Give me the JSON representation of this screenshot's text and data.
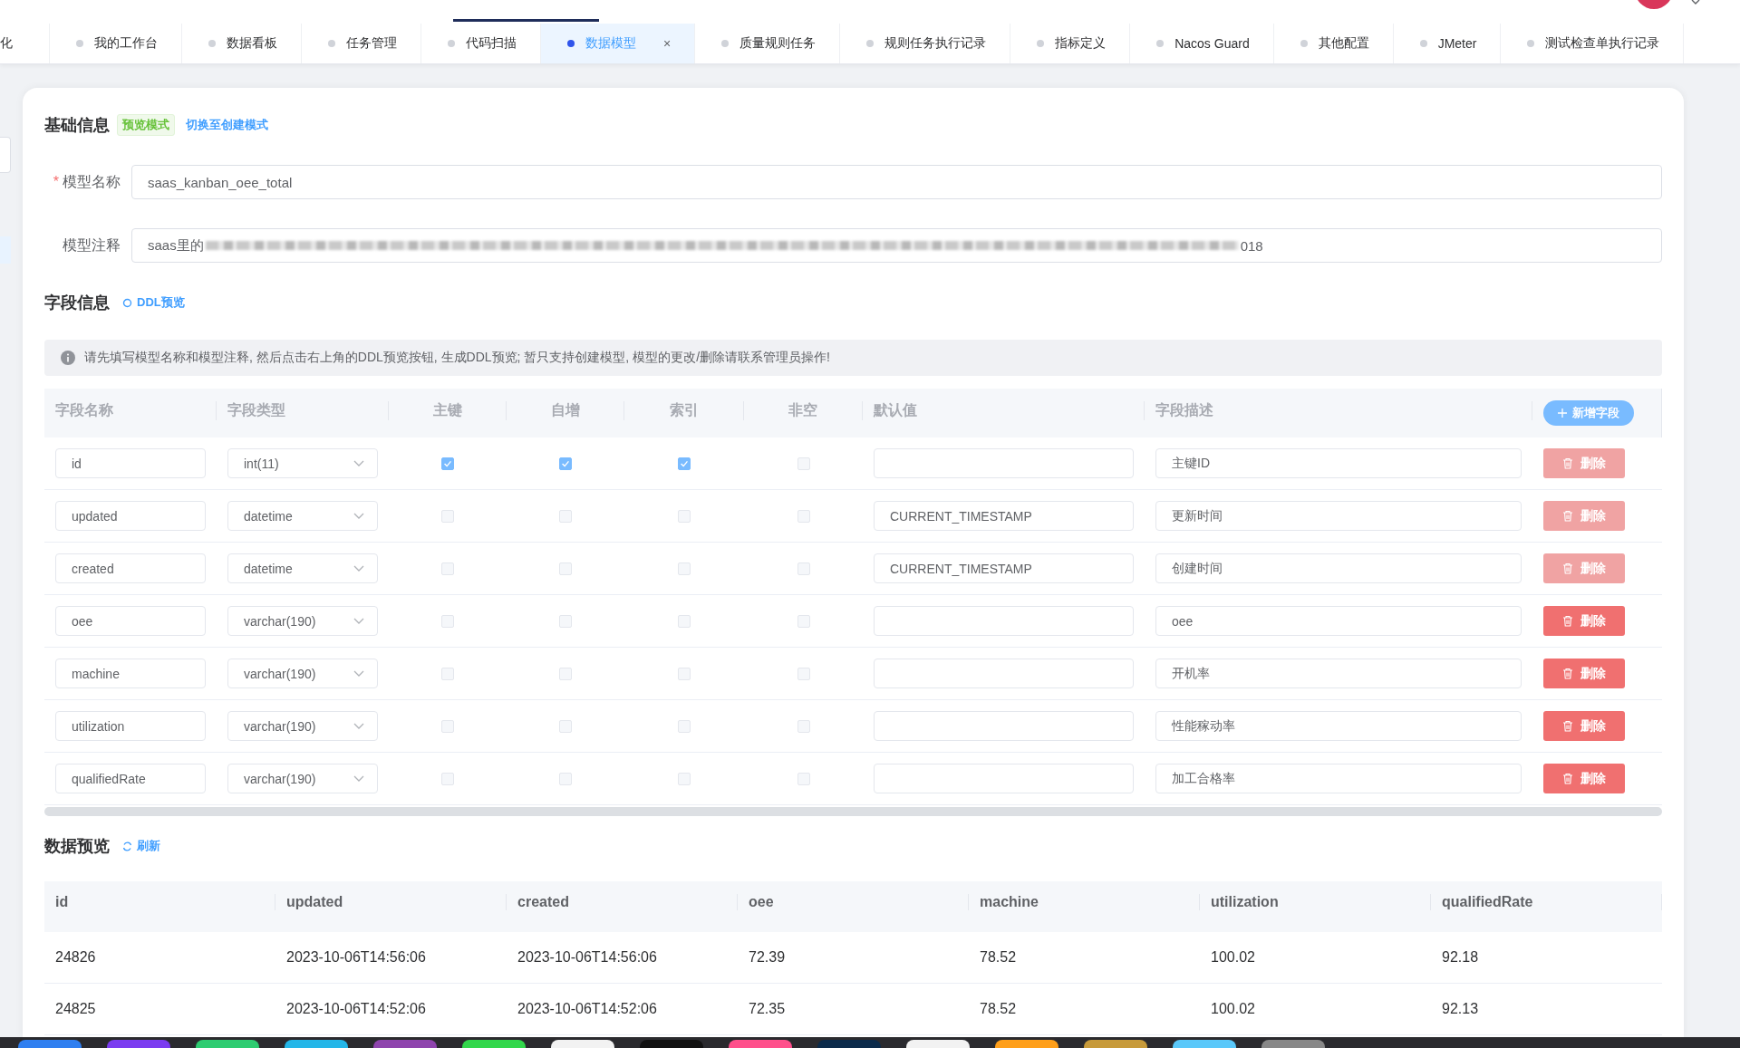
{
  "tabs": [
    {
      "label": "化",
      "kind": "cut",
      "selected": false
    },
    {
      "label": "我的工作台",
      "kind": "tab",
      "selected": false
    },
    {
      "label": "数据看板",
      "kind": "tab",
      "selected": false
    },
    {
      "label": "任务管理",
      "kind": "tab",
      "selected": false
    },
    {
      "label": "代码扫描",
      "kind": "tab",
      "selected": false
    },
    {
      "label": "数据模型",
      "kind": "tab",
      "selected": true,
      "close": "×"
    },
    {
      "label": "质量规则任务",
      "kind": "tab",
      "selected": false
    },
    {
      "label": "规则任务执行记录",
      "kind": "tab",
      "selected": false
    },
    {
      "label": "指标定义",
      "kind": "tab",
      "selected": false
    },
    {
      "label": "Nacos Guard",
      "kind": "tab",
      "selected": false
    },
    {
      "label": "其他配置",
      "kind": "tab",
      "selected": false
    },
    {
      "label": "JMeter",
      "kind": "tab",
      "selected": false
    },
    {
      "label": "测试检查单执行记录",
      "kind": "tab",
      "selected": false
    }
  ],
  "basic_info": {
    "title": "基础信息",
    "mode_tag": "预览模式",
    "switch_link": "切换至创建模式",
    "fields": [
      {
        "label": "模型名称",
        "required_mark": "*",
        "value": "saas_kanban_oee_total"
      },
      {
        "label": "模型注释",
        "value": "saas里的",
        "redacted": true,
        "value_end": "018"
      }
    ]
  },
  "field_info": {
    "title": "字段信息",
    "ddl_link": "DDL预览",
    "alert": "请先填写模型名称和模型注释, 然后点击右上角的DDL预览按钮, 生成DDL预览; 暂只支持创建模型, 模型的更改/删除请联系管理员操作!",
    "add_button": "新增字段",
    "columns": [
      "字段名称",
      "字段类型",
      "主键",
      "自增",
      "索引",
      "非空",
      "默认值",
      "字段描述"
    ],
    "rows": [
      {
        "name": "id",
        "type": "int(11)",
        "primary_key": true,
        "auto_increment": true,
        "index": true,
        "not_null": false,
        "default": "",
        "description": "主键ID",
        "delete_label": "删除",
        "delete_disabled": true
      },
      {
        "name": "updated",
        "type": "datetime",
        "primary_key": false,
        "auto_increment": false,
        "index": false,
        "not_null": false,
        "default": "CURRENT_TIMESTAMP",
        "description": "更新时间",
        "delete_label": "删除",
        "delete_disabled": true
      },
      {
        "name": "created",
        "type": "datetime",
        "primary_key": false,
        "auto_increment": false,
        "index": false,
        "not_null": false,
        "default": "CURRENT_TIMESTAMP",
        "description": "创建时间",
        "delete_label": "删除",
        "delete_disabled": true
      },
      {
        "name": "oee",
        "type": "varchar(190)",
        "primary_key": false,
        "auto_increment": false,
        "index": false,
        "not_null": false,
        "default": "",
        "description": "oee",
        "delete_label": "删除",
        "delete_disabled": false
      },
      {
        "name": "machine",
        "type": "varchar(190)",
        "primary_key": false,
        "auto_increment": false,
        "index": false,
        "not_null": false,
        "default": "",
        "description": "开机率",
        "delete_label": "删除",
        "delete_disabled": false
      },
      {
        "name": "utilization",
        "type": "varchar(190)",
        "primary_key": false,
        "auto_increment": false,
        "index": false,
        "not_null": false,
        "default": "",
        "description": "性能稼动率",
        "delete_label": "删除",
        "delete_disabled": false
      },
      {
        "name": "qualifiedRate",
        "type": "varchar(190)",
        "primary_key": false,
        "auto_increment": false,
        "index": false,
        "not_null": false,
        "default": "",
        "description": "加工合格率",
        "delete_label": "删除",
        "delete_disabled": false
      }
    ]
  },
  "data_preview": {
    "title": "数据预览",
    "refresh_link": "刷新",
    "columns": [
      "id",
      "updated",
      "created",
      "oee",
      "machine",
      "utilization",
      "qualifiedRate"
    ],
    "rows": [
      [
        "24826",
        "2023-10-06T14:56:06",
        "2023-10-06T14:56:06",
        "72.39",
        "78.52",
        "100.02",
        "92.18"
      ],
      [
        "24825",
        "2023-10-06T14:52:06",
        "2023-10-06T14:52:06",
        "72.35",
        "78.52",
        "100.02",
        "92.13"
      ]
    ]
  }
}
